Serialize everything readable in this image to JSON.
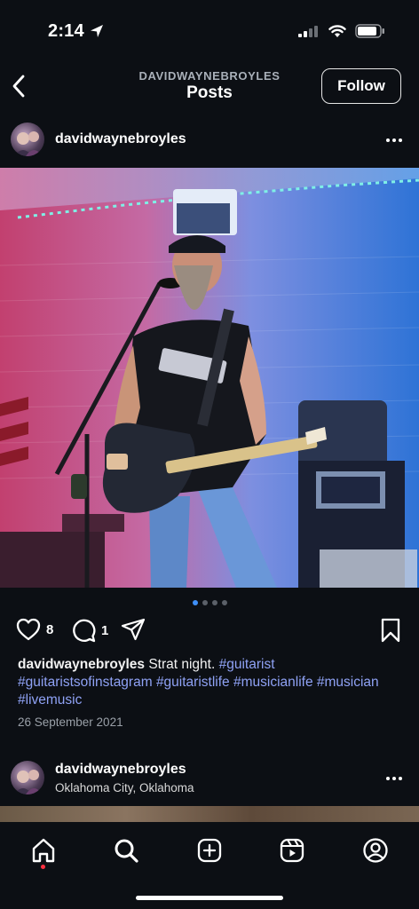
{
  "status_bar": {
    "time": "2:14"
  },
  "header": {
    "account": "DAVIDWAYNEBROYLES",
    "title": "Posts",
    "follow_label": "Follow"
  },
  "post": {
    "username": "davidwaynebroyles",
    "image_index": 1,
    "image_count": 4,
    "likes": "8",
    "comments": "1",
    "caption_text": "Strat night.",
    "hashtags": [
      "#guitarist",
      "#guitaristsofinstagram",
      "#guitaristlife",
      "#musicianlife",
      "#musician",
      "#livemusic"
    ],
    "date": "26 September 2021"
  },
  "next_post": {
    "username": "davidwaynebroyles",
    "location": "Oklahoma City, Oklahoma"
  },
  "tabbar": {
    "items": [
      "home-icon",
      "search-icon",
      "create-icon",
      "reels-icon",
      "profile-icon"
    ]
  },
  "colors": {
    "background": "#0c0f14",
    "hashtag": "#8fa2f5",
    "active_dot": "#3f8ff7",
    "notification": "#ff3040"
  }
}
